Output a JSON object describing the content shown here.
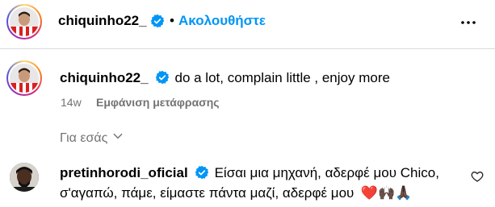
{
  "post_header": {
    "username": "chiquinho22_",
    "separator": "•",
    "follow_label": "Ακολουθήστε",
    "more_icon": "more-horizontal-icon"
  },
  "caption": {
    "username": "chiquinho22_",
    "text": "do a lot, complain little , enjoy more",
    "time": "14w",
    "translate_label": "Εμφάνιση μετάφρασης"
  },
  "for_you": {
    "label": "Για εσάς",
    "icon": "chevron-down-icon"
  },
  "comment": {
    "username": "pretinhorodi_oficial",
    "text_line1": "Είσαι μια μηχανή, αδερφέ μου Chico,",
    "text_line2": "σ'αγαπώ, πάμε, είμαστε πάντα μαζί, αδερφέ μου",
    "emojis": "❤️🙌🏿🙏🏿",
    "like_icon": "heart-outline-icon"
  },
  "colors": {
    "accent": "#0095f6",
    "verified": "#0095f6",
    "secondary_text": "#737373",
    "divider": "#dbdbdb"
  }
}
